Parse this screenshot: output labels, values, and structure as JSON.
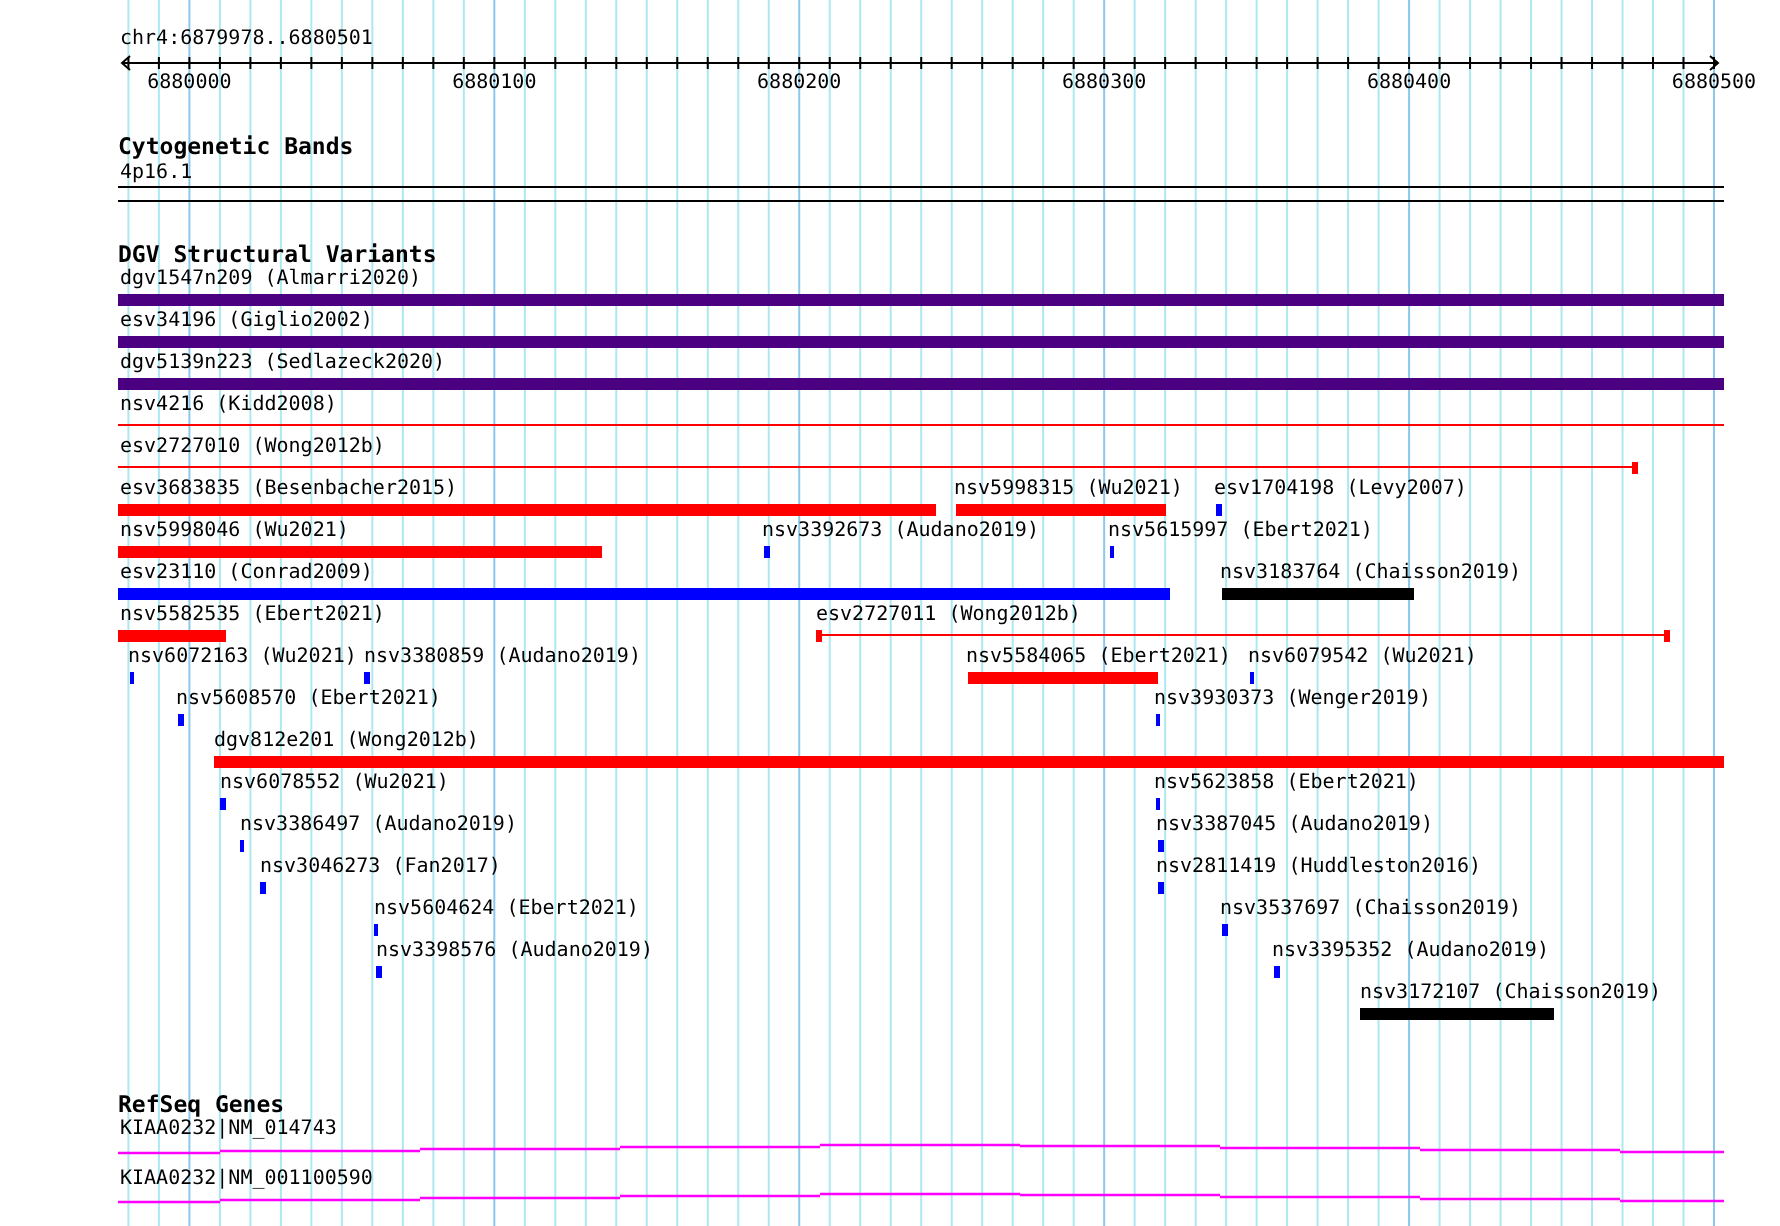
{
  "ruler": {
    "location": "chr4:6879978..6880501",
    "ticks": [
      "6880000",
      "6880100",
      "6880200",
      "6880300",
      "6880400",
      "6880500"
    ]
  },
  "tracks": [
    {
      "title": "Cytogenetic Bands",
      "kind": "bands",
      "features": [
        {
          "label": "4p16.1"
        }
      ]
    },
    {
      "title": "DGV Structural Variants",
      "kind": "variants",
      "features": [
        {
          "label": "dgv1547n209 (Almarri2020)",
          "kind": "bar",
          "color": "#4b0082"
        },
        {
          "label": "esv34196 (Giglio2002)",
          "kind": "bar",
          "color": "#4b0082"
        },
        {
          "label": "dgv5139n223 (Sedlazeck2020)",
          "kind": "bar",
          "color": "#4b0082"
        },
        {
          "label": "nsv4216 (Kidd2008)",
          "kind": "line",
          "color": "#ff0000"
        },
        {
          "label": "esv2727010 (Wong2012b)",
          "kind": "line",
          "color": "#ff0000"
        },
        {
          "label": "esv3683835 (Besenbacher2015)",
          "kind": "bar",
          "color": "#ff0000"
        },
        {
          "label": "nsv5998315 (Wu2021)",
          "kind": "bar",
          "color": "#ff0000"
        },
        {
          "label": "esv1704198 (Levy2007)",
          "kind": "bar",
          "color": "#0000ff"
        },
        {
          "label": "nsv5998046 (Wu2021)",
          "kind": "bar",
          "color": "#ff0000"
        },
        {
          "label": "nsv3392673 (Audano2019)",
          "kind": "bar",
          "color": "#0000ff"
        },
        {
          "label": "nsv5615997 (Ebert2021)",
          "kind": "bar",
          "color": "#0000ff"
        },
        {
          "label": "esv23110 (Conrad2009)",
          "kind": "bar",
          "color": "#0000ff"
        },
        {
          "label": "nsv3183764 (Chaisson2019)",
          "kind": "bar",
          "color": "#000000"
        },
        {
          "label": "nsv5582535 (Ebert2021)",
          "kind": "bar",
          "color": "#ff0000"
        },
        {
          "label": "esv2727011 (Wong2012b)",
          "kind": "line",
          "color": "#ff0000"
        },
        {
          "label": "nsv6072163 (Wu2021)",
          "kind": "bar",
          "color": "#0000ff"
        },
        {
          "label": "nsv3380859 (Audano2019)",
          "kind": "bar",
          "color": "#0000ff"
        },
        {
          "label": "nsv5584065 (Ebert2021)",
          "kind": "bar",
          "color": "#ff0000"
        },
        {
          "label": "nsv6079542 (Wu2021)",
          "kind": "bar",
          "color": "#0000ff"
        },
        {
          "label": "nsv5608570 (Ebert2021)",
          "kind": "bar",
          "color": "#0000ff"
        },
        {
          "label": "nsv3930373 (Wenger2019)",
          "kind": "bar",
          "color": "#0000ff"
        },
        {
          "label": "dgv812e201 (Wong2012b)",
          "kind": "bar",
          "color": "#ff0000"
        },
        {
          "label": "nsv6078552 (Wu2021)",
          "kind": "bar",
          "color": "#0000ff"
        },
        {
          "label": "nsv5623858 (Ebert2021)",
          "kind": "bar",
          "color": "#0000ff"
        },
        {
          "label": "nsv3386497 (Audano2019)",
          "kind": "bar",
          "color": "#0000ff"
        },
        {
          "label": "nsv3387045 (Audano2019)",
          "kind": "bar",
          "color": "#0000ff"
        },
        {
          "label": "nsv3046273 (Fan2017)",
          "kind": "bar",
          "color": "#0000ff"
        },
        {
          "label": "nsv2811419 (Huddleston2016)",
          "kind": "bar",
          "color": "#0000ff"
        },
        {
          "label": "nsv5604624 (Ebert2021)",
          "kind": "bar",
          "color": "#0000ff"
        },
        {
          "label": "nsv3537697 (Chaisson2019)",
          "kind": "bar",
          "color": "#0000ff"
        },
        {
          "label": "nsv3398576 (Audano2019)",
          "kind": "bar",
          "color": "#0000ff"
        },
        {
          "label": "nsv3395352 (Audano2019)",
          "kind": "bar",
          "color": "#0000ff"
        },
        {
          "label": "nsv3172107 (Chaisson2019)",
          "kind": "bar",
          "color": "#000000"
        }
      ]
    },
    {
      "title": "RefSeq Genes",
      "kind": "genes",
      "features": [
        {
          "label": "KIAA0232|NM_014743"
        },
        {
          "label": "KIAA0232|NM_001100590"
        }
      ]
    }
  ]
}
